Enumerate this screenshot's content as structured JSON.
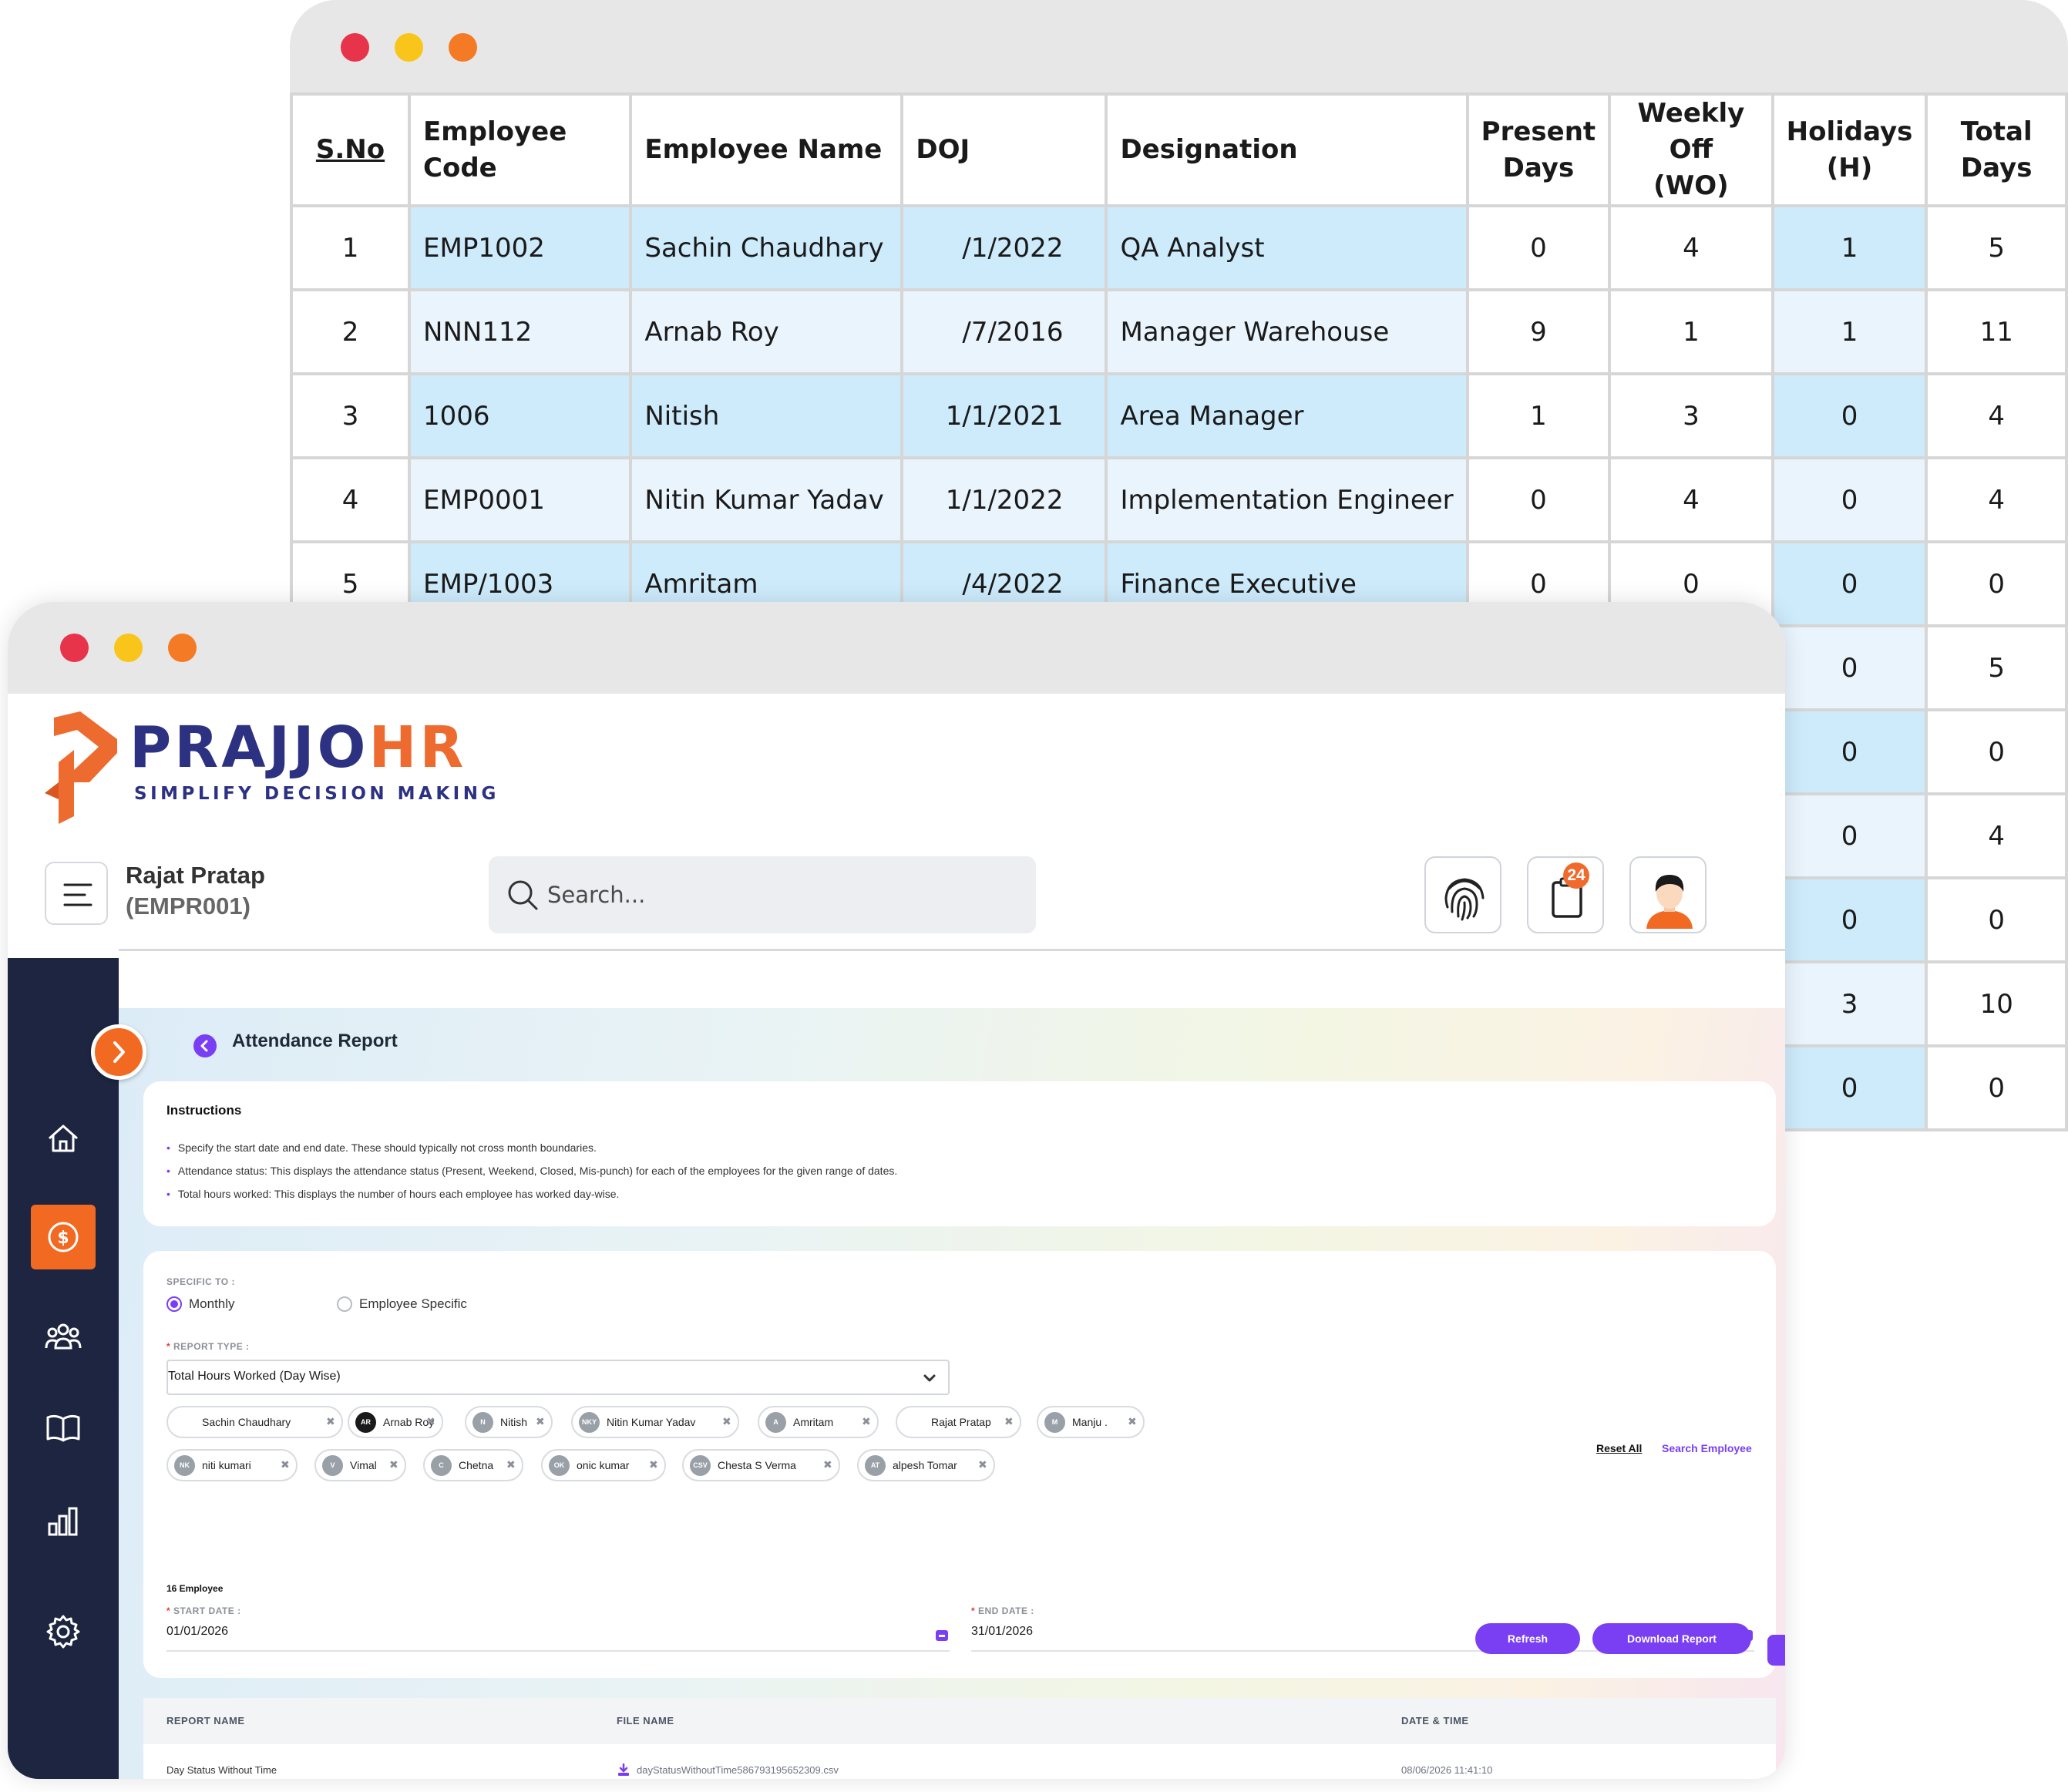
{
  "attendance_table": {
    "headers": [
      {
        "key": "sno",
        "lines": [
          "S.No"
        ]
      },
      {
        "key": "code",
        "lines": [
          "Employee Code"
        ]
      },
      {
        "key": "name",
        "lines": [
          "Employee Name"
        ]
      },
      {
        "key": "doj",
        "lines": [
          "DOJ"
        ]
      },
      {
        "key": "designation",
        "lines": [
          "Designation"
        ]
      },
      {
        "key": "present",
        "lines": [
          "Present",
          "Days"
        ]
      },
      {
        "key": "weekly_off",
        "lines": [
          "Weekly Off",
          "(WO)"
        ]
      },
      {
        "key": "holidays",
        "lines": [
          "Holidays",
          "(H)"
        ]
      },
      {
        "key": "total",
        "lines": [
          "Total",
          "Days"
        ]
      }
    ],
    "rows": [
      {
        "sno": "1",
        "code": "EMP1002",
        "name": "Sachin Chaudhary",
        "doj": "/1/2022",
        "designation": "QA Analyst",
        "present": "0",
        "weekly_off": "4",
        "holidays": "1",
        "total": "5"
      },
      {
        "sno": "2",
        "code": "NNN112",
        "name": "Arnab Roy",
        "doj": "/7/2016",
        "designation": "Manager Warehouse",
        "present": "9",
        "weekly_off": "1",
        "holidays": "1",
        "total": "11"
      },
      {
        "sno": "3",
        "code": "1006",
        "name": "Nitish",
        "doj": "1/1/2021",
        "designation": "Area Manager",
        "present": "1",
        "weekly_off": "3",
        "holidays": "0",
        "total": "4"
      },
      {
        "sno": "4",
        "code": "EMP0001",
        "name": "Nitin Kumar Yadav",
        "doj": "1/1/2022",
        "designation": "Implementation Engineer",
        "present": "0",
        "weekly_off": "4",
        "holidays": "0",
        "total": "4"
      },
      {
        "sno": "5",
        "code": "EMP/1003",
        "name": "Amritam",
        "doj": "/4/2022",
        "designation": "Finance Executive",
        "present": "0",
        "weekly_off": "0",
        "holidays": "0",
        "total": "0"
      },
      {
        "holidays": "0",
        "total": "5"
      },
      {
        "holidays": "0",
        "total": "0"
      },
      {
        "holidays": "0",
        "total": "4"
      },
      {
        "holidays": "0",
        "total": "0"
      },
      {
        "holidays": "3",
        "total": "10"
      },
      {
        "holidays": "0",
        "total": "0"
      }
    ]
  },
  "app": {
    "logo": {
      "word_main": "PRAJJO",
      "word_accent": "HR",
      "tagline": "SIMPLIFY DECISION MAKING"
    },
    "user": {
      "name": "Rajat Pratap",
      "code": "(EMPR001)"
    },
    "search": {
      "placeholder": "Search..."
    },
    "notifications": {
      "count": "24"
    },
    "page_title": "Attendance Report",
    "instructions": {
      "title": "Instructions",
      "items": [
        "Specify the start date and end date. These should typically not cross month boundaries.",
        "Attendance status: This displays the attendance status (Present, Weekend, Closed, Mis-punch) for each of the employees for the given range of dates.",
        "Total hours worked: This displays the number of hours each employee has worked day-wise."
      ]
    },
    "form": {
      "specific_to_label": "SPECIFIC TO :",
      "options": [
        "Monthly",
        "Employee Specific"
      ],
      "selected_option": "Monthly",
      "report_type_label": "REPORT TYPE :",
      "report_type_value": "Total Hours Worked (Day Wise)",
      "reset_all": "Reset All",
      "search_employee": "Search Employee",
      "employees": [
        {
          "initials": "",
          "name": "Sachin Chaudhary"
        },
        {
          "initials": "AR",
          "name": "Arnab Roy"
        },
        {
          "initials": "N",
          "name": "Nitish"
        },
        {
          "initials": "NKY",
          "name": "Nitin Kumar Yadav"
        },
        {
          "initials": "A",
          "name": "Amritam"
        },
        {
          "initials": "",
          "name": "Rajat Pratap"
        },
        {
          "initials": "M",
          "name": "Manju ."
        },
        {
          "initials": "NK",
          "name": "niti kumari"
        },
        {
          "initials": "V",
          "name": "Vimal"
        },
        {
          "initials": "C",
          "name": "Chetna"
        },
        {
          "initials": "OK",
          "name": "onic kumar"
        },
        {
          "initials": "CSV",
          "name": "Chesta S Verma"
        },
        {
          "initials": "AT",
          "name": "alpesh Tomar"
        }
      ],
      "employee_count": "16 Employee",
      "start_date_label": "START DATE :",
      "start_date": "01/01/2026",
      "end_date_label": "END DATE :",
      "end_date": "31/01/2026",
      "refresh_label": "Refresh",
      "download_label": "Download Report"
    },
    "reports": {
      "headers": [
        "REPORT NAME",
        "FILE NAME",
        "DATE & TIME"
      ],
      "rows": [
        {
          "report_name": "Day Status Without Time",
          "file_name": "dayStatusWithoutTime586793195652309.csv",
          "date_time": "08/06/2026 11:41:10"
        }
      ]
    }
  },
  "colors": {
    "accent_orange": "#f26a22",
    "brand_navy": "#2c3181",
    "purple": "#7a3ff3",
    "sidebar_bg": "#1e2540",
    "row_blue": "#cdebfb",
    "row_light": "#eaf4fc"
  }
}
